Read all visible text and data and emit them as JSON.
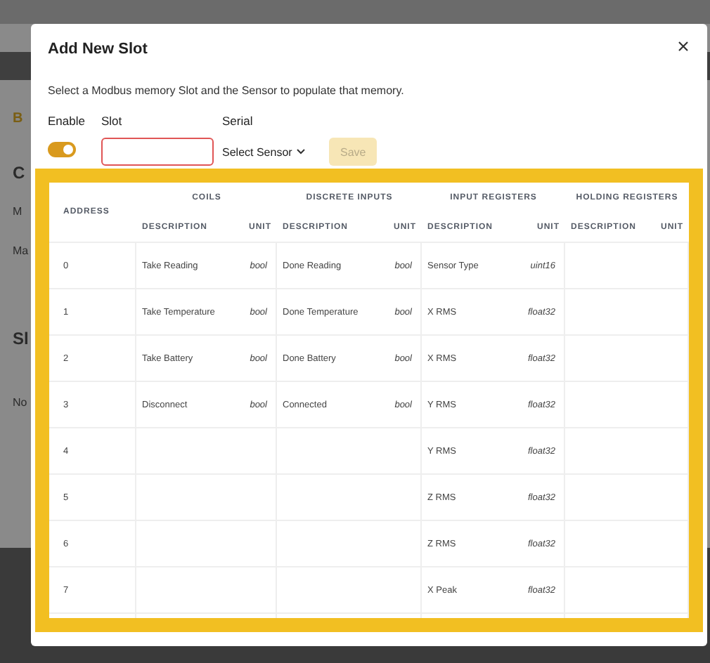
{
  "background_page": {
    "texts": [
      {
        "text": "B",
        "kind": "link"
      },
      {
        "text": "C",
        "kind": "heading"
      },
      {
        "text": "M",
        "kind": "label"
      },
      {
        "text": "Ma",
        "kind": "label"
      },
      {
        "text": "Sl",
        "kind": "heading"
      },
      {
        "text": "No",
        "kind": "label"
      }
    ]
  },
  "dialog": {
    "title": "Add New Slot",
    "description": "Select a Modbus memory Slot and the Sensor to populate that memory.",
    "enable": {
      "label": "Enable",
      "on": true
    },
    "slot": {
      "label": "Slot",
      "invalid": true
    },
    "serial": {
      "label": "Serial",
      "placeholder": "Select Sensor"
    },
    "save_button": {
      "label": "Save",
      "disabled": true
    },
    "table": {
      "address_header": "ADDRESS",
      "groups": [
        {
          "title": "COILS",
          "columns": [
            "DESCRIPTION",
            "UNIT"
          ]
        },
        {
          "title": "DISCRETE INPUTS",
          "columns": [
            "DESCRIPTION",
            "UNIT"
          ]
        },
        {
          "title": "INPUT REGISTERS",
          "columns": [
            "DESCRIPTION",
            "UNIT"
          ]
        },
        {
          "title": "HOLDING REGISTERS",
          "columns": [
            "DESCRIPTION",
            "UNIT"
          ]
        }
      ],
      "rows": [
        {
          "address": "0",
          "cells": [
            "Take Reading",
            "bool",
            "Done Reading",
            "bool",
            "Sensor Type",
            "uint16",
            "",
            ""
          ]
        },
        {
          "address": "1",
          "cells": [
            "Take Temperature",
            "bool",
            "Done Temperature",
            "bool",
            "X RMS",
            "float32",
            "",
            ""
          ]
        },
        {
          "address": "2",
          "cells": [
            "Take Battery",
            "bool",
            "Done Battery",
            "bool",
            "X RMS",
            "float32",
            "",
            ""
          ]
        },
        {
          "address": "3",
          "cells": [
            "Disconnect",
            "bool",
            "Connected",
            "bool",
            "Y RMS",
            "float32",
            "",
            ""
          ]
        },
        {
          "address": "4",
          "cells": [
            "",
            "",
            "",
            "",
            "Y RMS",
            "float32",
            "",
            ""
          ]
        },
        {
          "address": "5",
          "cells": [
            "",
            "",
            "",
            "",
            "Z RMS",
            "float32",
            "",
            ""
          ]
        },
        {
          "address": "6",
          "cells": [
            "",
            "",
            "",
            "",
            "Z RMS",
            "float32",
            "",
            ""
          ]
        },
        {
          "address": "7",
          "cells": [
            "",
            "",
            "",
            "",
            "X Peak",
            "float32",
            "",
            ""
          ]
        }
      ]
    }
  }
}
